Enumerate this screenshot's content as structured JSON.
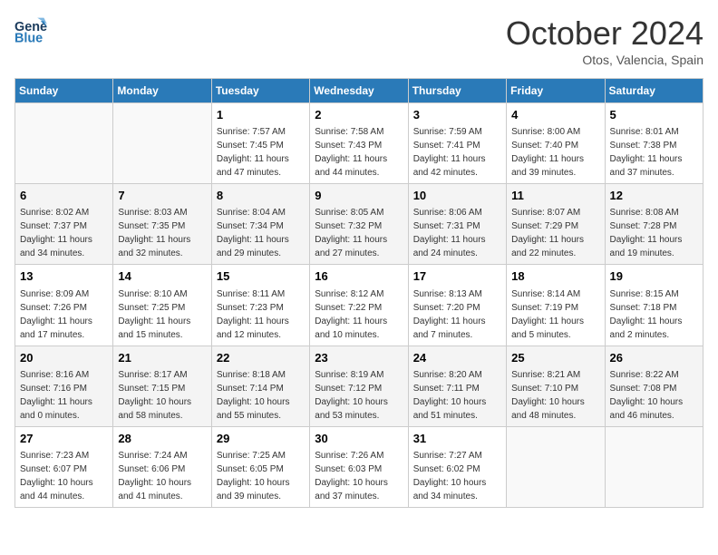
{
  "header": {
    "logo_line1": "General",
    "logo_line2": "Blue",
    "month_title": "October 2024",
    "location": "Otos, Valencia, Spain"
  },
  "days_of_week": [
    "Sunday",
    "Monday",
    "Tuesday",
    "Wednesday",
    "Thursday",
    "Friday",
    "Saturday"
  ],
  "weeks": [
    {
      "days": [
        {
          "num": "",
          "info": ""
        },
        {
          "num": "",
          "info": ""
        },
        {
          "num": "1",
          "info": "Sunrise: 7:57 AM\nSunset: 7:45 PM\nDaylight: 11 hours and 47 minutes."
        },
        {
          "num": "2",
          "info": "Sunrise: 7:58 AM\nSunset: 7:43 PM\nDaylight: 11 hours and 44 minutes."
        },
        {
          "num": "3",
          "info": "Sunrise: 7:59 AM\nSunset: 7:41 PM\nDaylight: 11 hours and 42 minutes."
        },
        {
          "num": "4",
          "info": "Sunrise: 8:00 AM\nSunset: 7:40 PM\nDaylight: 11 hours and 39 minutes."
        },
        {
          "num": "5",
          "info": "Sunrise: 8:01 AM\nSunset: 7:38 PM\nDaylight: 11 hours and 37 minutes."
        }
      ]
    },
    {
      "days": [
        {
          "num": "6",
          "info": "Sunrise: 8:02 AM\nSunset: 7:37 PM\nDaylight: 11 hours and 34 minutes."
        },
        {
          "num": "7",
          "info": "Sunrise: 8:03 AM\nSunset: 7:35 PM\nDaylight: 11 hours and 32 minutes."
        },
        {
          "num": "8",
          "info": "Sunrise: 8:04 AM\nSunset: 7:34 PM\nDaylight: 11 hours and 29 minutes."
        },
        {
          "num": "9",
          "info": "Sunrise: 8:05 AM\nSunset: 7:32 PM\nDaylight: 11 hours and 27 minutes."
        },
        {
          "num": "10",
          "info": "Sunrise: 8:06 AM\nSunset: 7:31 PM\nDaylight: 11 hours and 24 minutes."
        },
        {
          "num": "11",
          "info": "Sunrise: 8:07 AM\nSunset: 7:29 PM\nDaylight: 11 hours and 22 minutes."
        },
        {
          "num": "12",
          "info": "Sunrise: 8:08 AM\nSunset: 7:28 PM\nDaylight: 11 hours and 19 minutes."
        }
      ]
    },
    {
      "days": [
        {
          "num": "13",
          "info": "Sunrise: 8:09 AM\nSunset: 7:26 PM\nDaylight: 11 hours and 17 minutes."
        },
        {
          "num": "14",
          "info": "Sunrise: 8:10 AM\nSunset: 7:25 PM\nDaylight: 11 hours and 15 minutes."
        },
        {
          "num": "15",
          "info": "Sunrise: 8:11 AM\nSunset: 7:23 PM\nDaylight: 11 hours and 12 minutes."
        },
        {
          "num": "16",
          "info": "Sunrise: 8:12 AM\nSunset: 7:22 PM\nDaylight: 11 hours and 10 minutes."
        },
        {
          "num": "17",
          "info": "Sunrise: 8:13 AM\nSunset: 7:20 PM\nDaylight: 11 hours and 7 minutes."
        },
        {
          "num": "18",
          "info": "Sunrise: 8:14 AM\nSunset: 7:19 PM\nDaylight: 11 hours and 5 minutes."
        },
        {
          "num": "19",
          "info": "Sunrise: 8:15 AM\nSunset: 7:18 PM\nDaylight: 11 hours and 2 minutes."
        }
      ]
    },
    {
      "days": [
        {
          "num": "20",
          "info": "Sunrise: 8:16 AM\nSunset: 7:16 PM\nDaylight: 11 hours and 0 minutes."
        },
        {
          "num": "21",
          "info": "Sunrise: 8:17 AM\nSunset: 7:15 PM\nDaylight: 10 hours and 58 minutes."
        },
        {
          "num": "22",
          "info": "Sunrise: 8:18 AM\nSunset: 7:14 PM\nDaylight: 10 hours and 55 minutes."
        },
        {
          "num": "23",
          "info": "Sunrise: 8:19 AM\nSunset: 7:12 PM\nDaylight: 10 hours and 53 minutes."
        },
        {
          "num": "24",
          "info": "Sunrise: 8:20 AM\nSunset: 7:11 PM\nDaylight: 10 hours and 51 minutes."
        },
        {
          "num": "25",
          "info": "Sunrise: 8:21 AM\nSunset: 7:10 PM\nDaylight: 10 hours and 48 minutes."
        },
        {
          "num": "26",
          "info": "Sunrise: 8:22 AM\nSunset: 7:08 PM\nDaylight: 10 hours and 46 minutes."
        }
      ]
    },
    {
      "days": [
        {
          "num": "27",
          "info": "Sunrise: 7:23 AM\nSunset: 6:07 PM\nDaylight: 10 hours and 44 minutes."
        },
        {
          "num": "28",
          "info": "Sunrise: 7:24 AM\nSunset: 6:06 PM\nDaylight: 10 hours and 41 minutes."
        },
        {
          "num": "29",
          "info": "Sunrise: 7:25 AM\nSunset: 6:05 PM\nDaylight: 10 hours and 39 minutes."
        },
        {
          "num": "30",
          "info": "Sunrise: 7:26 AM\nSunset: 6:03 PM\nDaylight: 10 hours and 37 minutes."
        },
        {
          "num": "31",
          "info": "Sunrise: 7:27 AM\nSunset: 6:02 PM\nDaylight: 10 hours and 34 minutes."
        },
        {
          "num": "",
          "info": ""
        },
        {
          "num": "",
          "info": ""
        }
      ]
    }
  ]
}
